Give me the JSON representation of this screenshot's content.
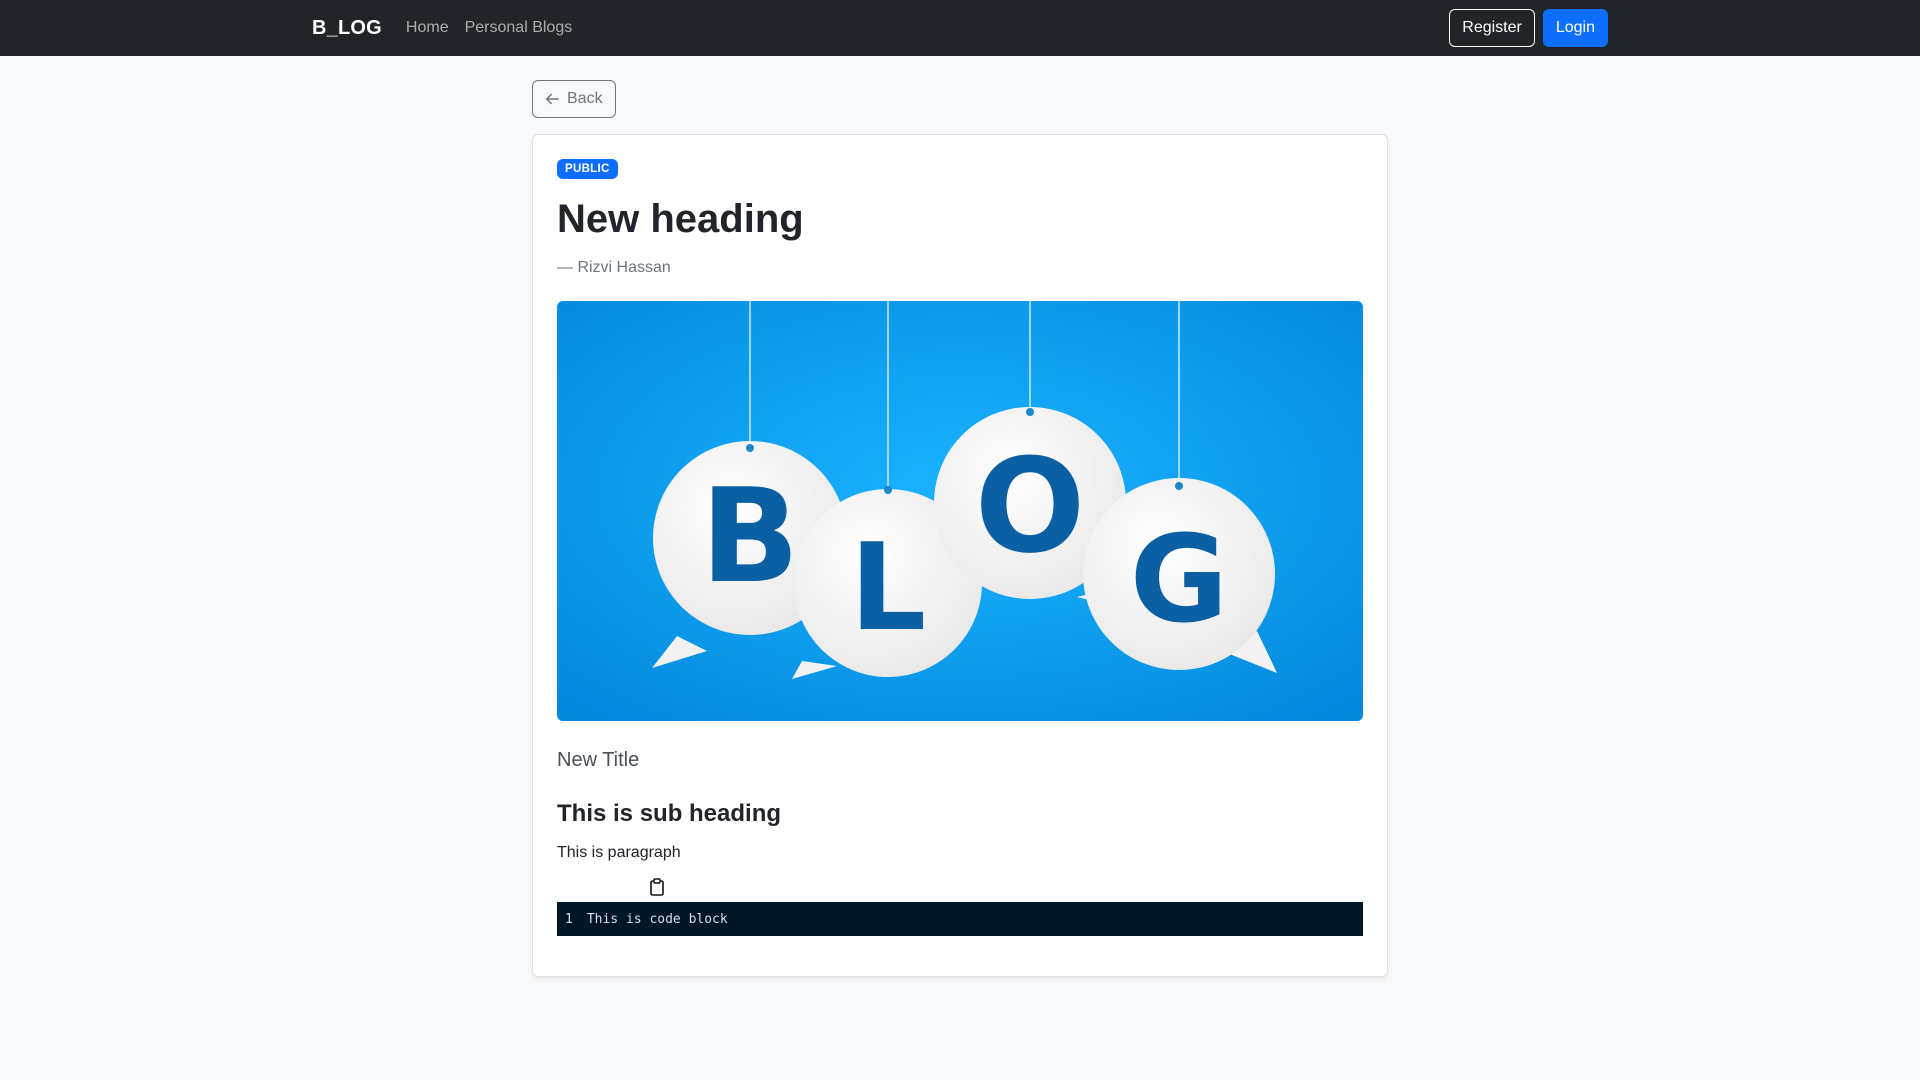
{
  "nav": {
    "brand": "B_LOG",
    "links": [
      "Home",
      "Personal Blogs"
    ],
    "register_label": "Register",
    "login_label": "Login"
  },
  "back_label": "Back",
  "post": {
    "badge": "PUBLIC",
    "title": "New heading",
    "author": "— Rizvi Hassan",
    "hero_letters": [
      "B",
      "L",
      "O",
      "G"
    ],
    "lead": "New Title",
    "subheading": "This is sub heading",
    "paragraph": "This is paragraph",
    "code": {
      "line_number": "1",
      "text": "This is code block"
    }
  },
  "colors": {
    "navbar": "#212529",
    "primary": "#0d6efd",
    "hero_blue": "#0aa2f2",
    "code_bg": "#011627"
  }
}
